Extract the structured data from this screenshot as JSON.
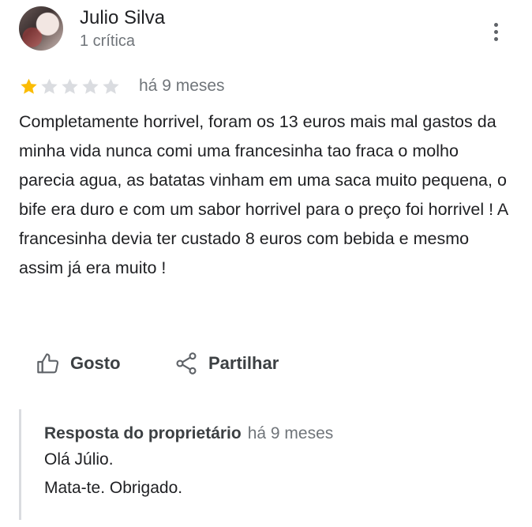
{
  "reviewer": {
    "name": "Julio Silva",
    "review_count": "1 crítica"
  },
  "review": {
    "rating": 1,
    "max_rating": 5,
    "date": "há 9 meses",
    "text": "Completamente horrivel, foram os 13 euros mais mal gastos da minha vida nunca comi uma francesinha tao fraca o molho parecia agua, as batatas vinham em uma saca muito pequena, o bife era duro e com um sabor horrivel para o preço foi horrivel ! A francesinha devia ter custado 8 euros com bebida e mesmo assim já era muito !"
  },
  "actions": {
    "like_label": "Gosto",
    "share_label": "Partilhar"
  },
  "owner_reply": {
    "title": "Resposta do proprietário",
    "date": "há 9 meses",
    "lines": [
      "Olá Júlio.",
      "Mata-te. Obrigado."
    ]
  },
  "colors": {
    "star_filled": "#fbbc04",
    "star_empty": "#dadce0",
    "secondary_text": "#70757a",
    "primary_text": "#202124"
  },
  "icons": {
    "more": "more-vert-icon",
    "like": "thumb-up-icon",
    "share": "share-icon",
    "star": "star-icon"
  }
}
